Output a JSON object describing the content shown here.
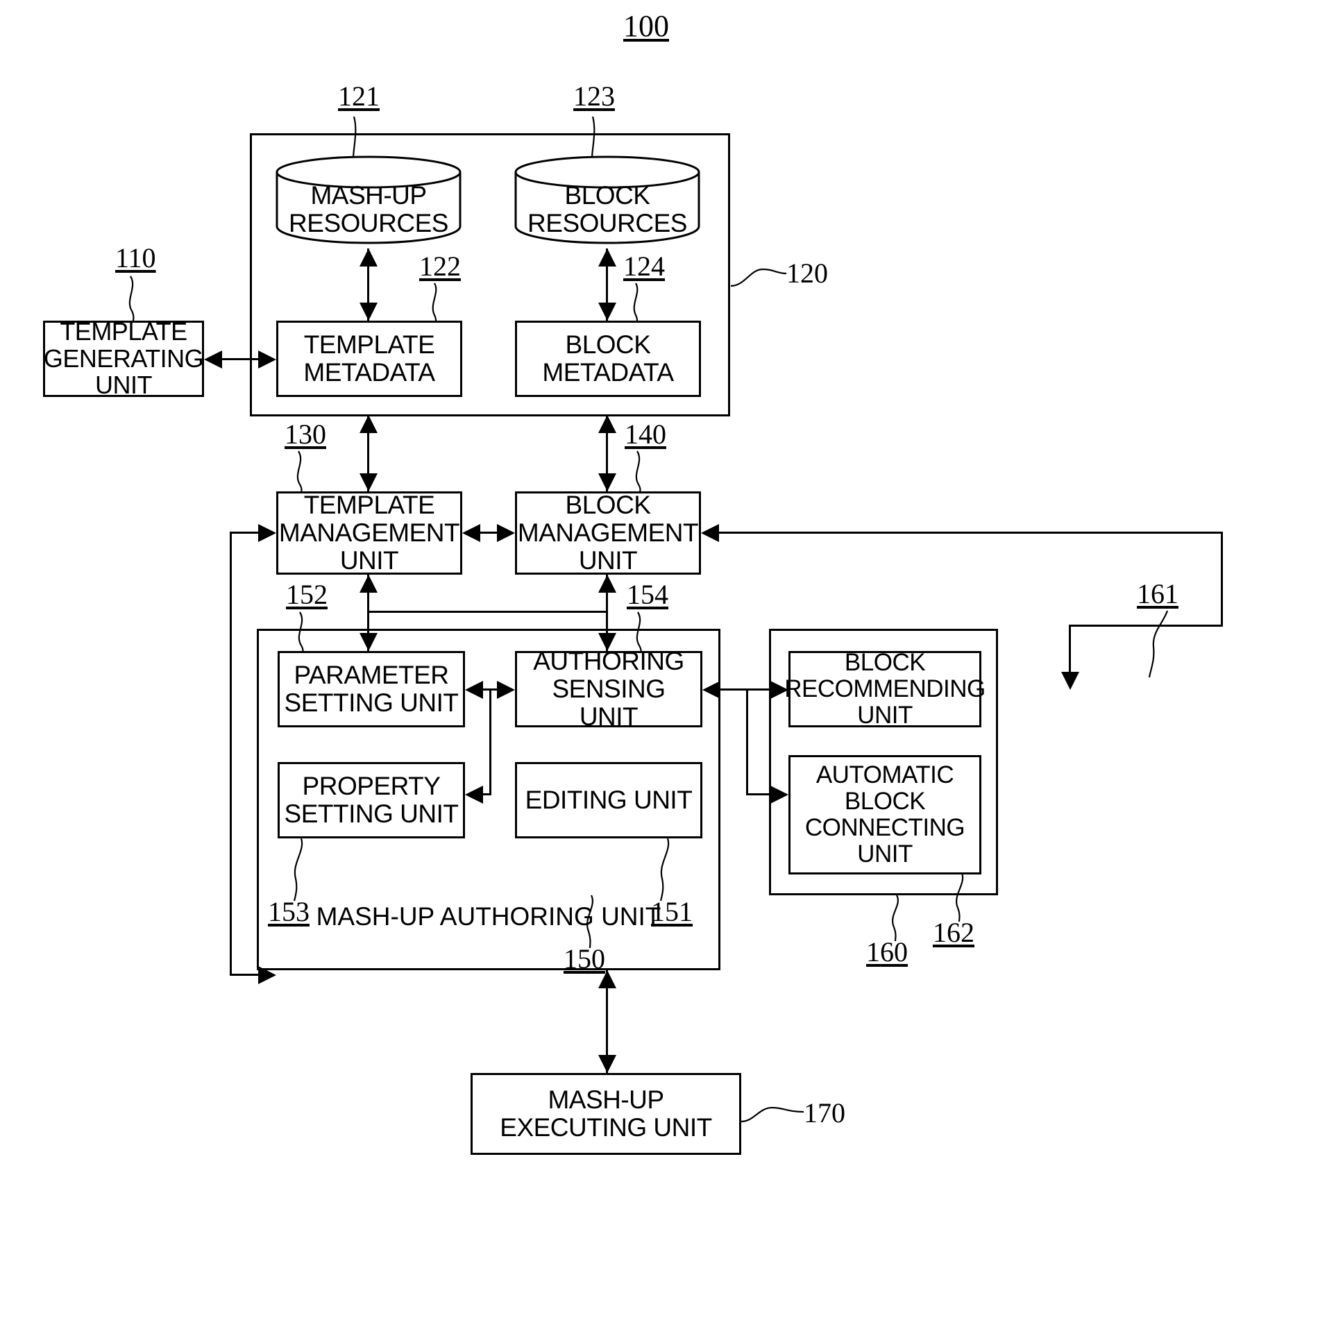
{
  "figure": {
    "system_number": "100",
    "title_number_position": "top-center"
  },
  "blocks": {
    "template_generating_unit": {
      "label": "TEMPLATE\nGENERATING\nUNIT",
      "ref": "110"
    },
    "resource_group": {
      "ref": "120"
    },
    "mashup_resources": {
      "label": "MASH-UP\nRESOURCES",
      "ref": "121"
    },
    "template_metadata": {
      "label": "TEMPLATE\nMETADATA",
      "ref": "122"
    },
    "block_resources": {
      "label": "BLOCK\nRESOURCES",
      "ref": "123"
    },
    "block_metadata": {
      "label": "BLOCK\nMETADATA",
      "ref": "124"
    },
    "template_management_unit": {
      "label": "TEMPLATE\nMANAGEMENT\nUNIT",
      "ref": "130"
    },
    "block_management_unit": {
      "label": "BLOCK\nMANAGEMENT\nUNIT",
      "ref": "140"
    },
    "mashup_authoring_unit": {
      "label": "MASH-UP AUTHORING UNIT",
      "ref": "150"
    },
    "parameter_setting_unit": {
      "label": "PARAMETER\nSETTING UNIT",
      "ref": "152"
    },
    "authoring_sensing_unit": {
      "label": "AUTHORING\nSENSING UNIT",
      "ref": "154"
    },
    "property_setting_unit": {
      "label": "PROPERTY\nSETTING UNIT",
      "ref": "153"
    },
    "editing_unit": {
      "label": "EDITING UNIT",
      "ref": "151"
    },
    "recommendation_group": {
      "ref": "160"
    },
    "block_recommending_unit": {
      "label": "BLOCK\nRECOMMENDING\nUNIT",
      "ref": "161"
    },
    "automatic_block_connecting_unit": {
      "label": "AUTOMATIC\nBLOCK\nCONNECTING\nUNIT",
      "ref": "162"
    },
    "mashup_executing_unit": {
      "label": "MASH-UP\nEXECUTING UNIT",
      "ref": "170"
    }
  },
  "refs": {
    "n100": "100",
    "n110": "110",
    "n120": "120",
    "n121": "121",
    "n122": "122",
    "n123": "123",
    "n124": "124",
    "n130": "130",
    "n140": "140",
    "n150": "150",
    "n151": "151",
    "n152": "152",
    "n153": "153",
    "n154": "154",
    "n160": "160",
    "n161": "161",
    "n162": "162",
    "n170": "170"
  },
  "colors": {
    "stroke": "#000000",
    "background": "#ffffff"
  }
}
